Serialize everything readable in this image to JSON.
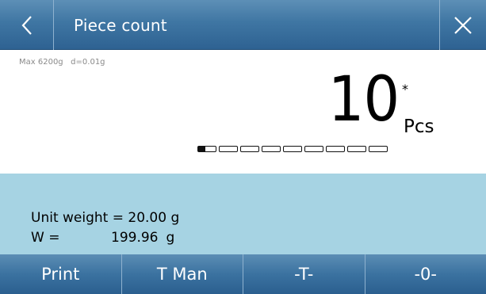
{
  "header": {
    "title": "Piece count",
    "back_icon": "chevron-left-icon",
    "close_icon": "close-icon"
  },
  "display": {
    "spec": "Max 6200g   d=0.01g",
    "reading": "10",
    "stability_mark": "*",
    "unit": "Pcs",
    "bar_segments": 9,
    "bar_fill_fraction": 0.04
  },
  "info": {
    "unit_weight_label": "Unit weight = ",
    "unit_weight_value": "20.00 g",
    "weight_label": "W =",
    "weight_value": "199.96",
    "weight_unit": "g"
  },
  "footer": {
    "buttons": [
      "Print",
      "T Man",
      "-T-",
      "-0-"
    ]
  },
  "colors": {
    "header_blue": "#3f76a3",
    "info_panel": "#a6d3e3"
  }
}
